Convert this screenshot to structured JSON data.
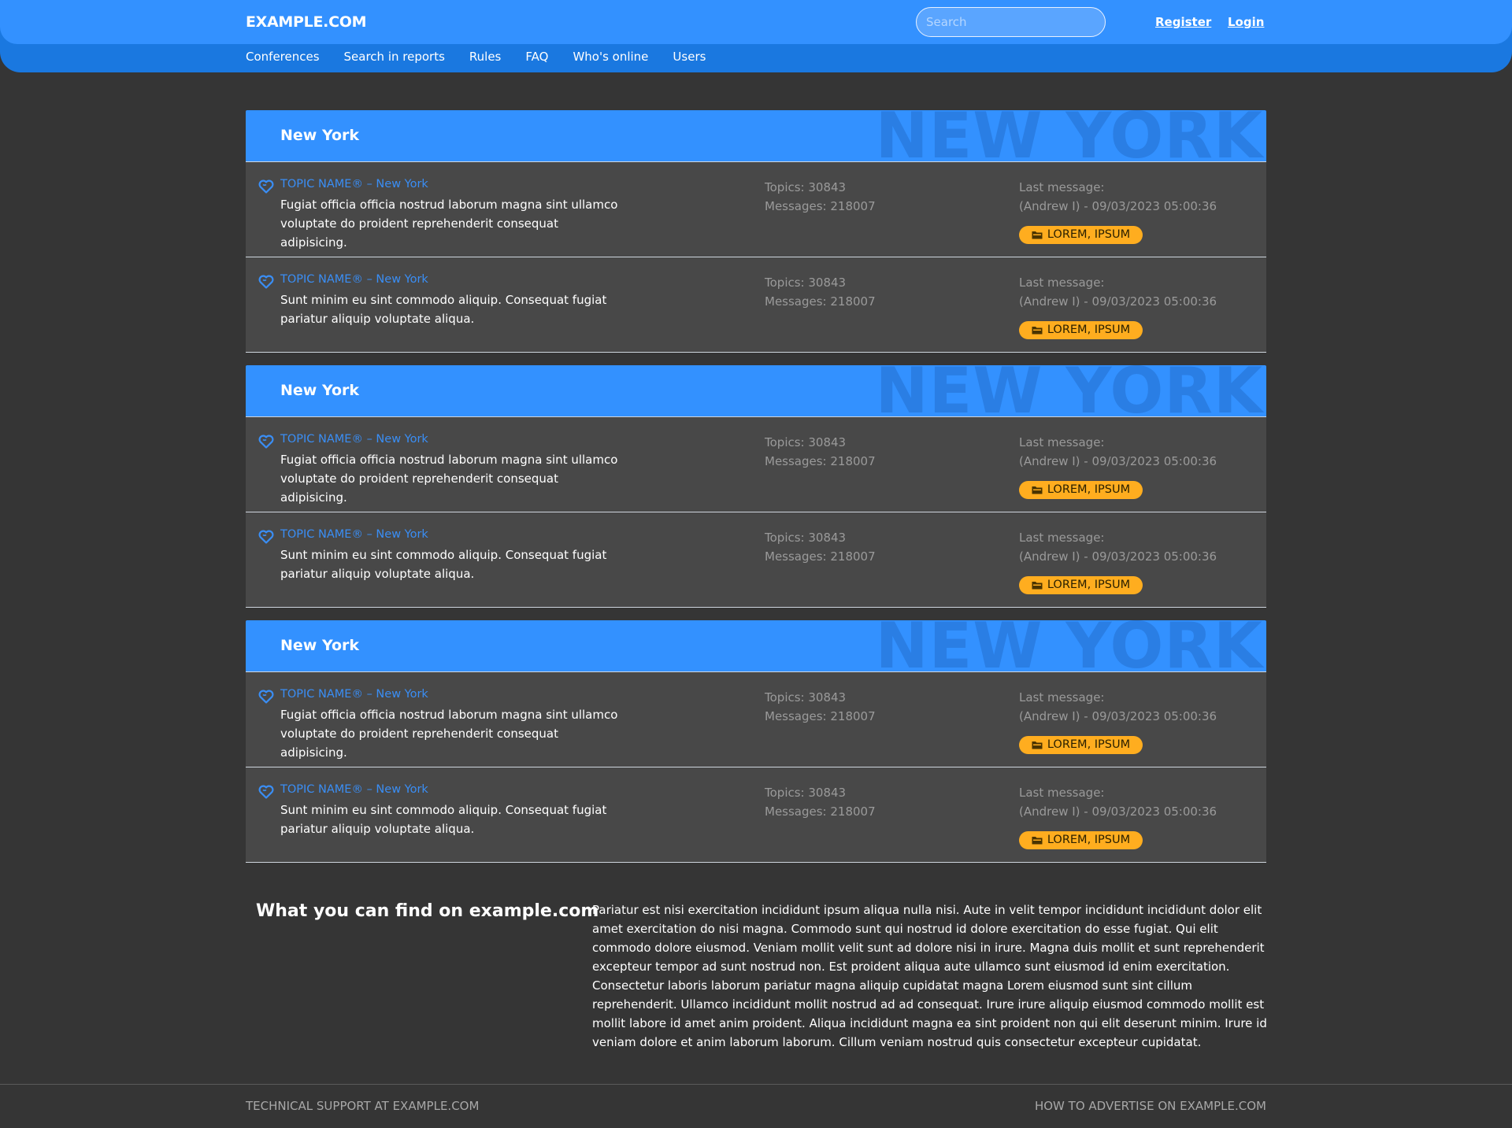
{
  "header": {
    "logo": "EXAMPLE.COM",
    "search_placeholder": "Search",
    "register": "Register",
    "login": "Login"
  },
  "nav": [
    "Conferences",
    "Search in reports",
    "Rules",
    "FAQ",
    "Who's online",
    "Users"
  ],
  "sections": [
    {
      "title": "New York",
      "watermark": "NEW YORK",
      "rows": [
        {
          "topic": "TOPIC NAME® – New York",
          "desc": "Fugiat officia officia nostrud laborum magna sint ullamco voluptate do proident reprehenderit consequat adipisicing.",
          "topics": "Topics: 30843",
          "messages": "Messages: 218007",
          "last_label": "Last message:",
          "last_value": "(Andrew I) - 09/03/2023 05:00:36",
          "badge": "LOREM, IPSUM"
        },
        {
          "topic": "TOPIC NAME® – New York",
          "desc": "Sunt minim eu sint commodo aliquip. Consequat fugiat pariatur aliquip voluptate aliqua.",
          "topics": "Topics: 30843",
          "messages": "Messages: 218007",
          "last_label": "Last message:",
          "last_value": "(Andrew I) - 09/03/2023 05:00:36",
          "badge": "LOREM, IPSUM"
        }
      ]
    },
    {
      "title": "New York",
      "watermark": "NEW YORK",
      "rows": [
        {
          "topic": "TOPIC NAME® – New York",
          "desc": "Fugiat officia officia nostrud laborum magna sint ullamco voluptate do proident reprehenderit consequat adipisicing.",
          "topics": "Topics: 30843",
          "messages": "Messages: 218007",
          "last_label": "Last message:",
          "last_value": "(Andrew I) - 09/03/2023 05:00:36",
          "badge": "LOREM, IPSUM"
        },
        {
          "topic": "TOPIC NAME® – New York",
          "desc": "Sunt minim eu sint commodo aliquip. Consequat fugiat pariatur aliquip voluptate aliqua.",
          "topics": "Topics: 30843",
          "messages": "Messages: 218007",
          "last_label": "Last message:",
          "last_value": "(Andrew I) - 09/03/2023 05:00:36",
          "badge": "LOREM, IPSUM"
        }
      ]
    },
    {
      "title": "New York",
      "watermark": "NEW YORK",
      "rows": [
        {
          "topic": "TOPIC NAME® – New York",
          "desc": "Fugiat officia officia nostrud laborum magna sint ullamco voluptate do proident reprehenderit consequat adipisicing.",
          "topics": "Topics: 30843",
          "messages": "Messages: 218007",
          "last_label": "Last message:",
          "last_value": "(Andrew I) - 09/03/2023 05:00:36",
          "badge": "LOREM, IPSUM"
        },
        {
          "topic": "TOPIC NAME® – New York",
          "desc": "Sunt minim eu sint commodo aliquip. Consequat fugiat pariatur aliquip voluptate aliqua.",
          "topics": "Topics: 30843",
          "messages": "Messages: 218007",
          "last_label": "Last message:",
          "last_value": "(Andrew I) - 09/03/2023 05:00:36",
          "badge": "LOREM, IPSUM"
        }
      ]
    }
  ],
  "find": {
    "title": "What you can find on example.com",
    "text": "Pariatur est nisi exercitation incididunt ipsum aliqua nulla nisi. Aute in velit tempor incididunt incididunt dolor elit amet exercitation do nisi magna. Commodo sunt qui nostrud id dolore exercitation do esse fugiat. Qui elit commodo dolore eiusmod. Veniam mollit velit sunt ad dolore nisi in irure. Magna duis mollit et sunt reprehenderit excepteur tempor ad sunt nostrud non. Est proident aliqua aute ullamco sunt eiusmod id enim exercitation. Consectetur laboris laborum pariatur magna aliquip cupidatat magna Lorem eiusmod sunt sint cillum reprehenderit. Ullamco incididunt mollit nostrud ad ad consequat. Irure irure aliquip eiusmod commodo mollit est mollit labore id amet anim proident. Aliqua incididunt magna ea sint proident non qui elit deserunt minim. Irure id veniam dolore et anim laborum laborum. Cillum veniam nostrud quis consectetur excepteur cupidatat."
  },
  "footer": {
    "left": "TECHNICAL SUPPORT AT EXAMPLE.COM",
    "right": "HOW TO ADVERTISE ON EXAMPLE.COM"
  },
  "colors": {
    "header_primary": "#3391ff",
    "header_secondary": "#1a78e0",
    "background": "#353535",
    "row_background": "#484848",
    "link": "#3a8ef5",
    "badge": "#ffad1f"
  },
  "icons": {
    "topic": "heart-icon",
    "badge": "folder-icon"
  }
}
